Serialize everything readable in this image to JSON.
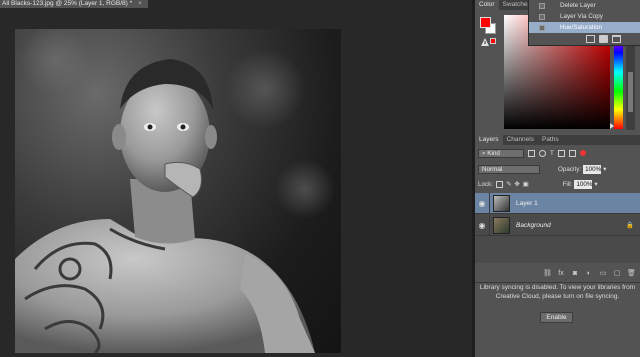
{
  "document": {
    "tab_title": "All Blacks-123.jpg @ 25% (Layer 1, RGB/8) *",
    "close_glyph": "×"
  },
  "color_panel": {
    "tabs": [
      "Color",
      "Swatches"
    ],
    "foreground_color": "#ff0000",
    "background_color": "#ffffff"
  },
  "history": {
    "items": [
      {
        "label": "Delete Layer",
        "selected": false
      },
      {
        "label": "Layer Via Copy",
        "selected": false
      },
      {
        "label": "Hue/Saturation",
        "selected": true
      }
    ]
  },
  "layers_panel": {
    "tabs": [
      "Layers",
      "Channels",
      "Paths"
    ],
    "filter_kind": "Kind",
    "blend_mode": "Normal",
    "opacity_label": "Opacity:",
    "opacity_value": "100%",
    "lock_label": "Lock:",
    "fill_label": "Fill:",
    "fill_value": "100%",
    "layers": [
      {
        "name": "Layer 1",
        "visible": true,
        "selected": true,
        "italic": false
      },
      {
        "name": "Background",
        "visible": true,
        "selected": false,
        "italic": true
      }
    ],
    "footer_icons": [
      "link-icon",
      "fx-icon",
      "mask-icon",
      "adjustment-icon",
      "folder-icon",
      "new-layer-icon",
      "trash-icon"
    ]
  },
  "libraries": {
    "message": "Library syncing is disabled. To view your libraries from Creative Cloud, please turn on file syncing.",
    "enable_label": "Enable"
  },
  "icons": {
    "eye": "👁",
    "lock": "🔒",
    "fx": "fx"
  }
}
